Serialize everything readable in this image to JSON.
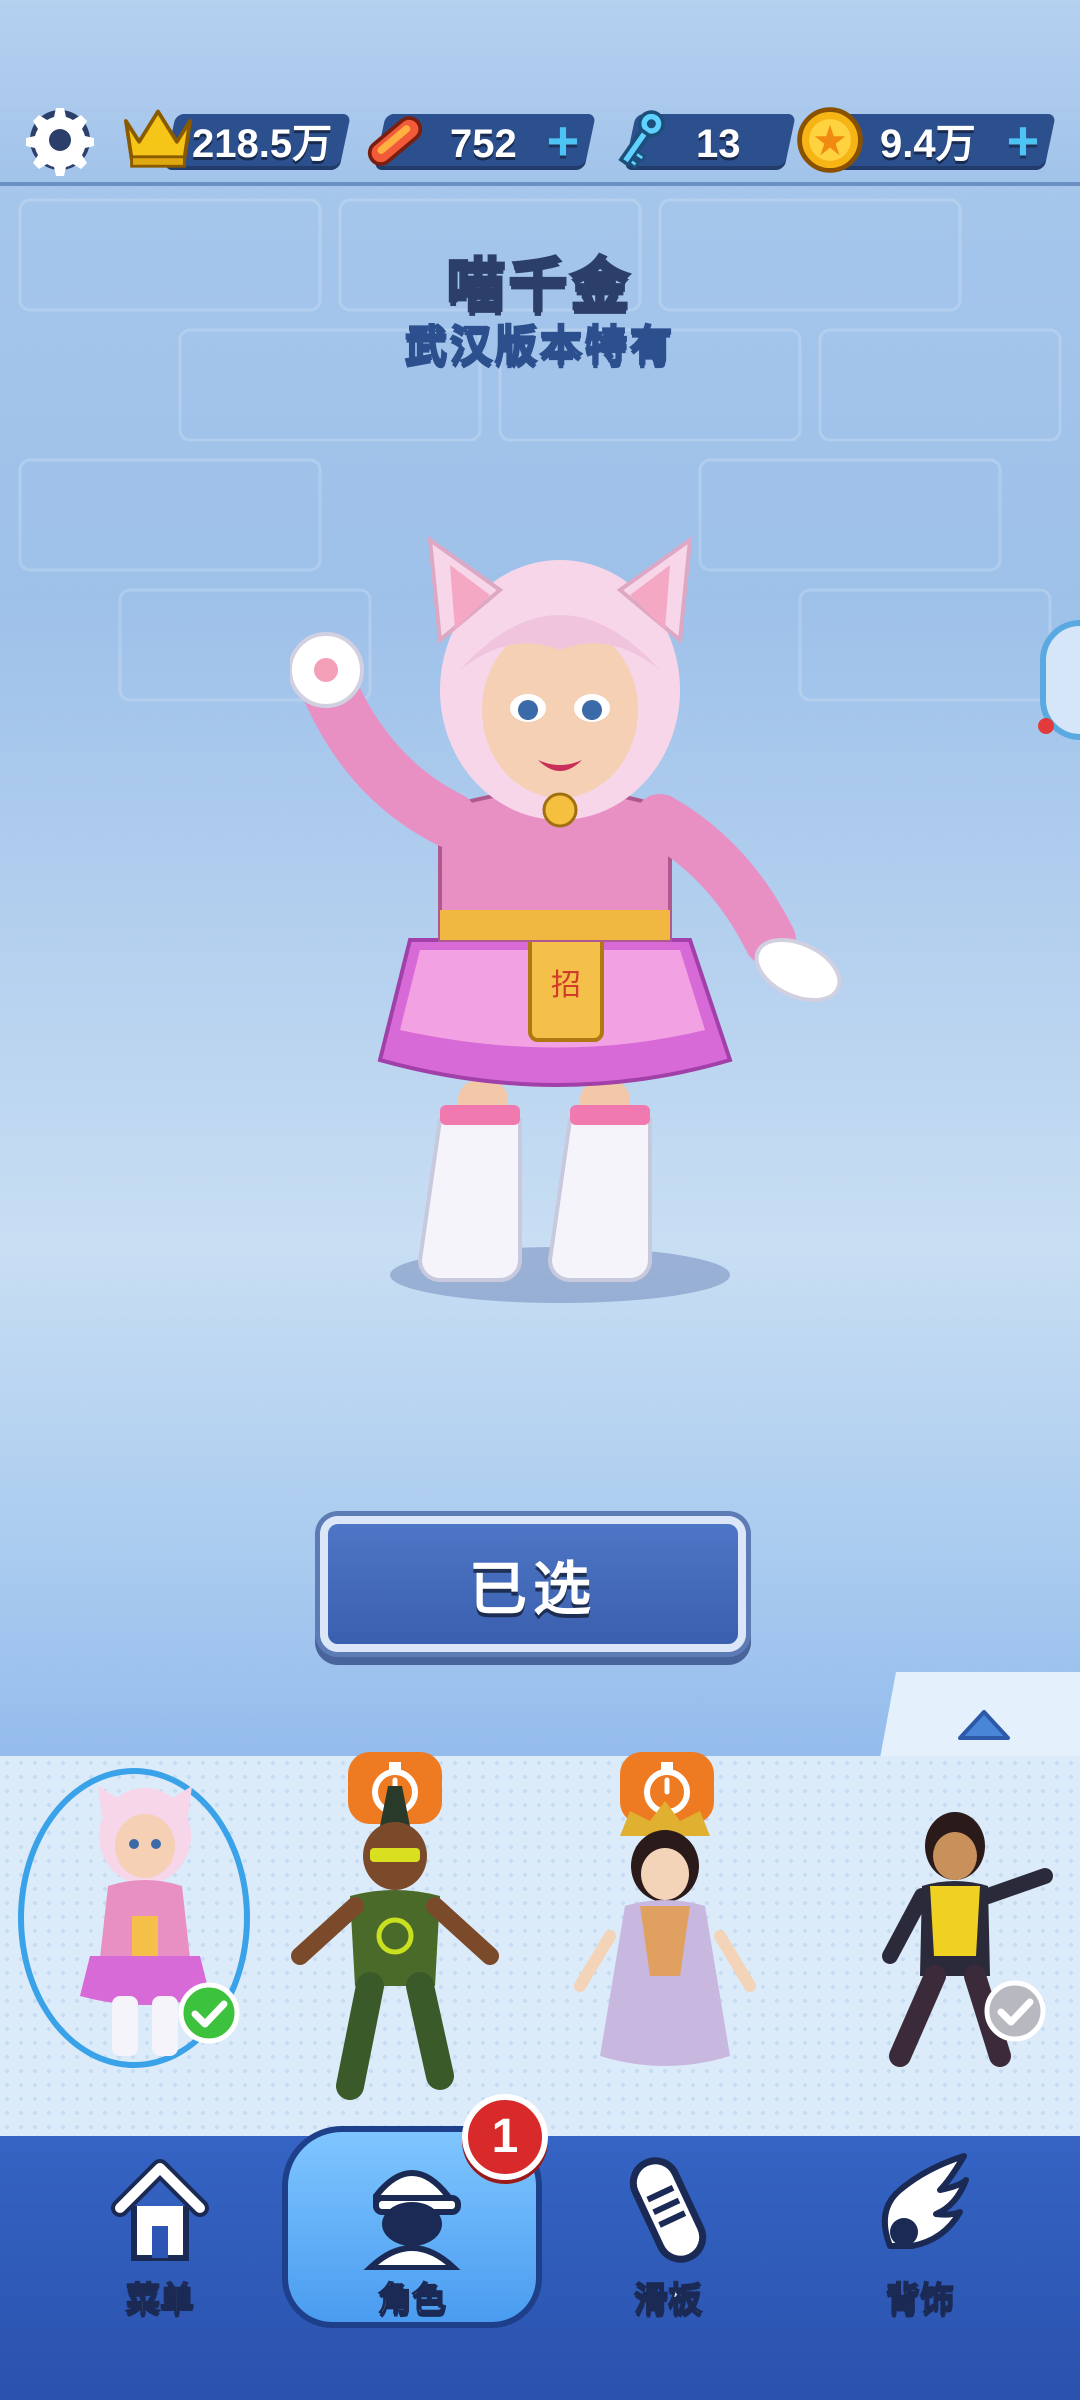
{
  "currency": {
    "trophy_value": "218.5万",
    "skateboard_value": "752",
    "key_value": "13",
    "coin_value": "9.4万",
    "plus_symbol": "+"
  },
  "character": {
    "name": "喵千金",
    "subtitle": "武汉版本特有"
  },
  "select_button": {
    "label": "已选"
  },
  "nav": {
    "items": [
      {
        "label": "菜单",
        "icon": "home-icon"
      },
      {
        "label": "角色",
        "icon": "character-icon",
        "active": true
      },
      {
        "label": "滑板",
        "icon": "skateboard-icon"
      },
      {
        "label": "背饰",
        "icon": "wings-icon"
      }
    ],
    "badge_count": "1"
  },
  "colors": {
    "accent_blue": "#3a5fae",
    "nav_bg": "#2d56b4",
    "timer_orange": "#ee7a22",
    "check_green": "#3cc23c",
    "badge_red": "#d82a2a"
  }
}
